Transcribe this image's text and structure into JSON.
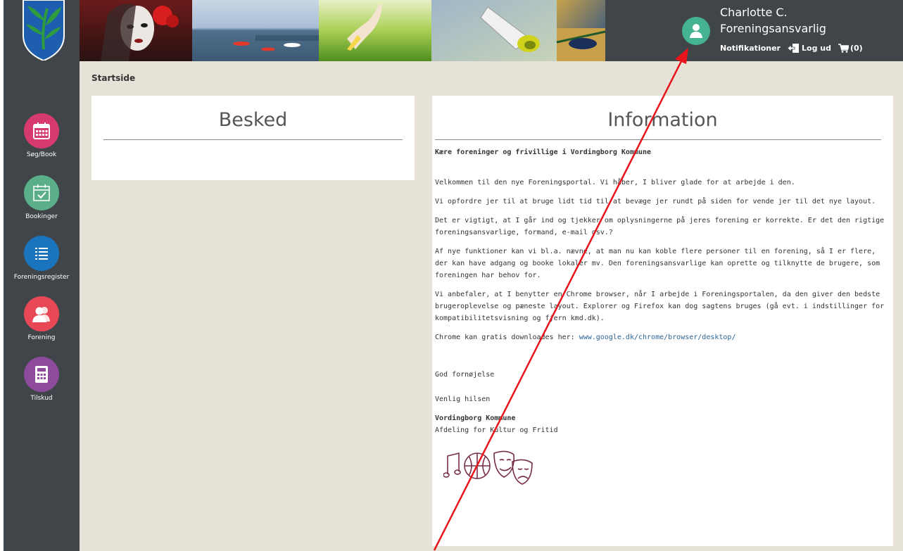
{
  "sidebar": {
    "items": [
      {
        "label": "Søg/Book",
        "color": "#d63a6f"
      },
      {
        "label": "Bookinger",
        "color": "#5aae88"
      },
      {
        "label": "Foreningsregister",
        "color": "#1a74be"
      },
      {
        "label": "Forening",
        "color": "#e84855"
      },
      {
        "label": "Tilskud",
        "color": "#8e4a9c"
      }
    ]
  },
  "user": {
    "name": "Charlotte C.",
    "role": "Foreningsansvarlig",
    "notifications_label": "Notifikationer",
    "logout_label": "Log ud",
    "cart_label": "(0)"
  },
  "breadcrumb": "Startside",
  "besked": {
    "title": "Besked"
  },
  "information": {
    "title": "Information",
    "heading": "Kære foreninger og frivillige i Vordingborg Kommune",
    "p1": "Velkommen til den nye Foreningsportal. Vi håber, I bliver glade for at arbejde i den.",
    "p2": "Vi opfordre jer til at bruge lidt tid til at bevæge jer rundt på siden for vende jer til det nye layout.",
    "p3": "Det er vigtigt, at I går ind og tjekker om oplysningerne på jeres forening er korrekte. Er det den rigtige foreningsansvarlige, formand, e-mail osv.?",
    "p4": "Af nye funktioner kan vi bl.a. nævne, at man nu kan koble flere personer til en forening, så I er flere, der kan have adgang og booke lokaler mv. Den foreningsansvarlige kan oprette og tilknytte de brugere, som foreningen har behov for.",
    "p5": "Vi anbefaler, at I benytter en Chrome browser, når I arbejde i Foreningsportalen, da den giver den bedste brugeroplevelse og pæneste layout. Explorer og Firefox kan dog sagtens bruges (gå evt. i indstillinger for kompatibilitetsvisning og fjern kmd.dk).",
    "p6_prefix": "Chrome kan gratis downloades her: ",
    "p6_link": "www.google.dk/chrome/browser/desktop/",
    "closing1": "God fornøjelse",
    "closing2": "Venlig hilsen",
    "sig_org": "Vordingborg Kommune",
    "sig_dept": "Afdeling for Kultur og Fritid"
  },
  "colors": {
    "sidebar_bg": "#3f4549",
    "main_bg": "#e6e2d8",
    "avatar": "#45b393",
    "annotation_arrow": "#e8141c",
    "link": "#2a6496"
  }
}
